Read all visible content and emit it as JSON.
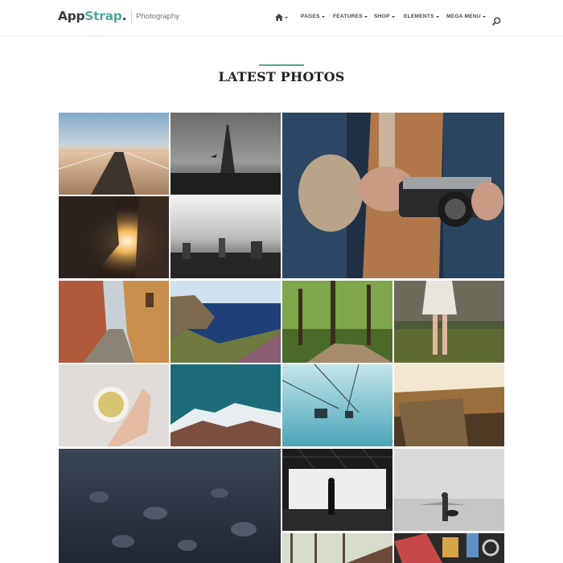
{
  "brand": {
    "name_main": "App",
    "name_accent": "Strap",
    "name_dot": ".",
    "tagline": "Photography"
  },
  "nav": {
    "home_icon": "home-icon",
    "items": [
      {
        "label": "PAGES"
      },
      {
        "label": "FEATURES"
      },
      {
        "label": "SHOP"
      },
      {
        "label": "ELEMENTS"
      },
      {
        "label": "MEGA MENU"
      }
    ],
    "search_icon": "search-icon"
  },
  "section": {
    "title": "LATEST PHOTOS"
  },
  "photos": [
    {
      "subject": "pier"
    },
    {
      "subject": "eiffel-tower"
    },
    {
      "subject": "hands-camera"
    },
    {
      "subject": "sunset-street"
    },
    {
      "subject": "city-fog"
    },
    {
      "subject": "alley"
    },
    {
      "subject": "coast"
    },
    {
      "subject": "forest-road"
    },
    {
      "subject": "woman-field"
    },
    {
      "subject": "tea-cup"
    },
    {
      "subject": "mountains"
    },
    {
      "subject": "cable-car"
    },
    {
      "subject": "tree-stump"
    },
    {
      "subject": "river-stones"
    },
    {
      "subject": "window-silhouette"
    },
    {
      "subject": "beach-guitar"
    },
    {
      "subject": "bare-trees"
    },
    {
      "subject": "bike-locks"
    }
  ],
  "colors": {
    "accent": "#55a79a",
    "text": "#222222",
    "nav_text": "#444444"
  }
}
